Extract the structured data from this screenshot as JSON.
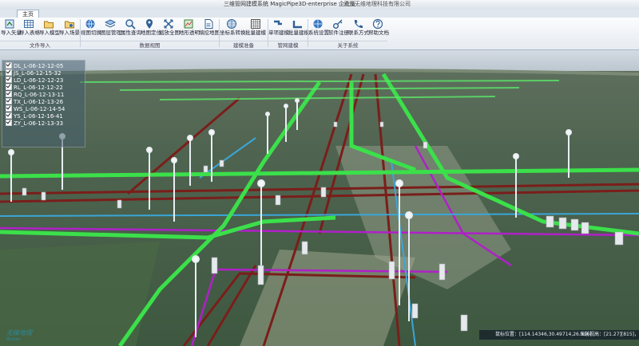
{
  "window": {
    "title": "三维管网建模系统 MagicPipe3D-enterprise 企业版",
    "company": "武汉无维地理科技有限公司"
  },
  "ribbon": {
    "active_tab": "主页",
    "buttons": [
      {
        "label": "导入矢量",
        "icon": "import-vector-icon"
      },
      {
        "label": "导入表格",
        "icon": "import-table-icon"
      },
      {
        "label": "导入模型",
        "icon": "import-model-icon"
      },
      {
        "label": "导入场景",
        "icon": "import-scene-icon"
      },
      {
        "label": "视图切换",
        "icon": "view-switch-icon"
      },
      {
        "label": "图层管理",
        "icon": "layers-icon"
      },
      {
        "label": "属性查询",
        "icon": "query-icon"
      },
      {
        "label": "地图定位",
        "icon": "location-pin-icon"
      },
      {
        "label": "缩放全图",
        "icon": "zoom-full-icon"
      },
      {
        "label": "地形透明",
        "icon": "terrain-transparent-icon"
      },
      {
        "label": "填挖地图",
        "icon": "cut-fill-icon"
      },
      {
        "label": "坐标系转换",
        "icon": "globe-icon"
      },
      {
        "label": "批量建模",
        "icon": "batch-model-icon"
      },
      {
        "label": "单项建模",
        "icon": "single-model-icon"
      },
      {
        "label": "批量建模",
        "icon": "batch-build-icon"
      },
      {
        "label": "系统设置",
        "icon": "settings-globe-icon"
      },
      {
        "label": "软件注册",
        "icon": "key-icon"
      },
      {
        "label": "联系方式",
        "icon": "phone-icon"
      },
      {
        "label": "帮助文档",
        "icon": "help-icon"
      }
    ],
    "groups": [
      "文件导入",
      "数据视图",
      "建模准备",
      "管网建模",
      "关于系统"
    ]
  },
  "layers": [
    {
      "label": "DL_L-06-12-12-05",
      "checked": true
    },
    {
      "label": "JS_L-06-12-15-32",
      "checked": true
    },
    {
      "label": "LD_L-06-12-12-23",
      "checked": true
    },
    {
      "label": "RL_L-06-12-12-22",
      "checked": true
    },
    {
      "label": "RQ_L-06-12-13-11",
      "checked": true
    },
    {
      "label": "TX_L-06-12-13-26",
      "checked": true
    },
    {
      "label": "WS_L-06-12-14-54",
      "checked": true
    },
    {
      "label": "YS_L-06-12-16-41",
      "checked": true
    },
    {
      "label": "ZY_L-06-12-13-33",
      "checked": true
    }
  ],
  "status": {
    "coords": "鼠标位置：[114.14346,30.49714,26.916]",
    "camera": "当前视高：[21.27][815]，1577]"
  },
  "logo": {
    "main": "无维地理",
    "sub": "Wuhan"
  },
  "colors": {
    "green_pipe": "#3be04a",
    "dark_red_pipe": "#7a1e1a",
    "magenta_pipe": "#b020c8",
    "cyan_pipe": "#3aa6d8"
  }
}
